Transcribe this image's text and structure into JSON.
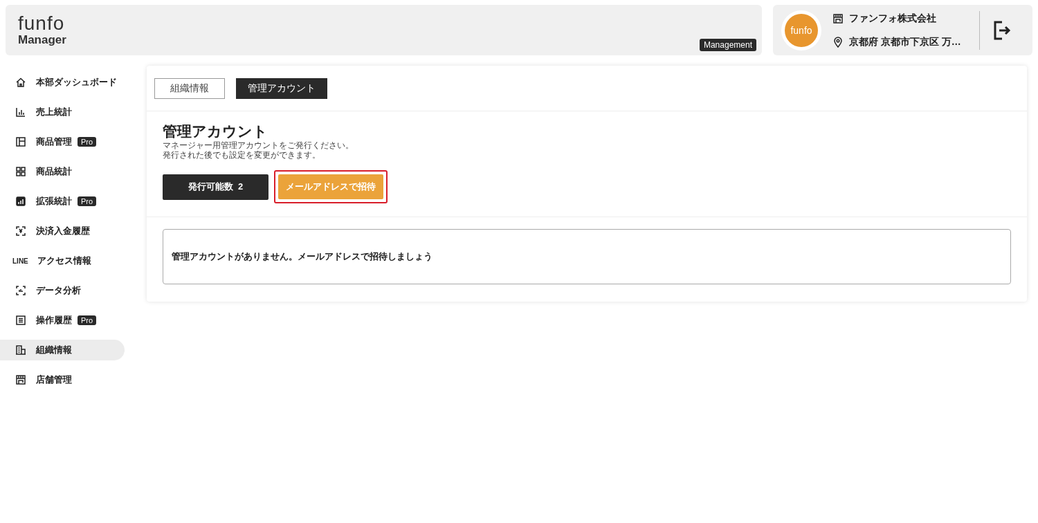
{
  "header": {
    "logo": "funfo",
    "subtitle": "Manager",
    "badge": "Management",
    "avatar_text": "funfo",
    "company": "ファンフォ株式会社",
    "address": "京都府 京都市下京区 万…"
  },
  "sidebar": {
    "items": [
      {
        "label": "本部ダッシュボード",
        "selected": false
      },
      {
        "label": "売上統計",
        "selected": false
      },
      {
        "label": "商品管理",
        "badge": "Pro",
        "selected": false
      },
      {
        "label": "商品統計",
        "selected": false
      },
      {
        "label": "拡張統計",
        "badge": "Pro",
        "selected": false
      },
      {
        "label": "決済入金履歴",
        "selected": false
      },
      {
        "label": "アクセス情報",
        "icon_text": "LINE",
        "selected": false
      },
      {
        "label": "データ分析",
        "selected": false
      },
      {
        "label": "操作履歴",
        "badge": "Pro",
        "selected": false
      },
      {
        "label": "組織情報",
        "selected": true
      },
      {
        "label": "店舗管理",
        "selected": false
      }
    ]
  },
  "tabs": [
    {
      "label": "組織情報",
      "selected": false
    },
    {
      "label": "管理アカウント",
      "selected": true
    }
  ],
  "section": {
    "title": "管理アカウント",
    "description": [
      "マネージャー用管理アカウントをご発行ください。",
      "発行された後でも設定を変更ができます。"
    ],
    "count_button": {
      "label": "発行可能数",
      "count": "2"
    },
    "invite_button": {
      "label": "メールアドレスで招待",
      "highlighted": true
    },
    "empty_message": "管理アカウントがありません。メールアドレスで招待しましょう"
  }
}
